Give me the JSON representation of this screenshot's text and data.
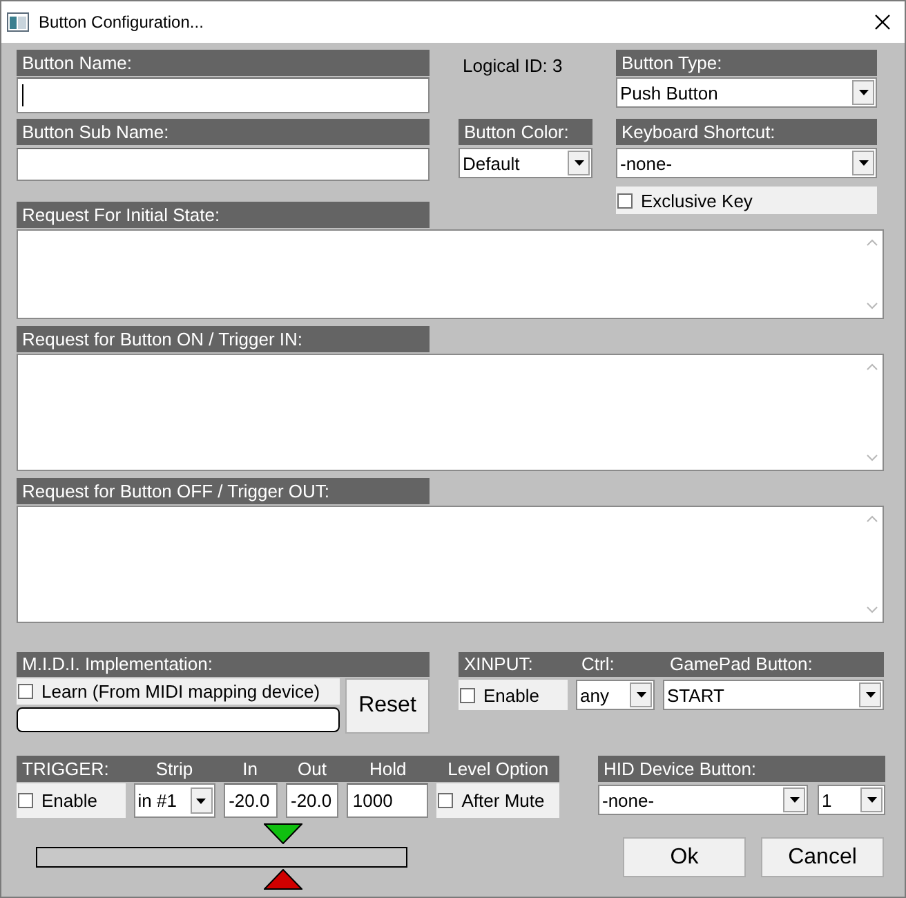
{
  "window": {
    "title": "Button Configuration..."
  },
  "button_name": {
    "label": "Button Name:",
    "focused": true
  },
  "logical_id": "Logical ID: 3",
  "button_type": {
    "label": "Button Type:",
    "value": "Push Button"
  },
  "button_sub_name": {
    "label": "Button Sub Name:"
  },
  "button_color": {
    "label": "Button Color:",
    "value": "Default"
  },
  "keyboard_shortcut": {
    "label": "Keyboard Shortcut:",
    "value": "-none-"
  },
  "exclusive_key": {
    "label": "Exclusive Key",
    "checked": false
  },
  "requests": [
    {
      "label": "Request For Initial State:"
    },
    {
      "label": "Request for Button ON / Trigger IN:"
    },
    {
      "label": "Request for Button OFF / Trigger OUT:"
    }
  ],
  "midi": {
    "label": "M.I.D.I. Implementation:",
    "learn": {
      "label": "Learn (From MIDI mapping device)",
      "checked": false
    },
    "reset": "Reset"
  },
  "xinput": {
    "labels": [
      "XINPUT:",
      "Ctrl:",
      "GamePad Button:"
    ],
    "enable": {
      "label": "Enable",
      "checked": false
    },
    "ctrl": "any",
    "gamepad_button": "START"
  },
  "trigger": {
    "labels": [
      "TRIGGER:",
      "Strip",
      "In",
      "Out",
      "Hold",
      "Level Option"
    ],
    "enable": {
      "label": "Enable",
      "checked": false
    },
    "strip": "in #1",
    "in": "-20.0",
    "out": "-20.0",
    "hold": "1000",
    "after_mute": {
      "label": "After Mute",
      "checked": false
    }
  },
  "threshold_meter": {
    "in_marker": {
      "level": 0.665
    },
    "out_marker": {
      "level": 0.665
    }
  },
  "hid": {
    "label": "HID Device Button:",
    "device_button": "-none-",
    "index": "1"
  },
  "buttons": [
    {
      "label": "Ok"
    },
    {
      "label": "Cancel"
    }
  ]
}
